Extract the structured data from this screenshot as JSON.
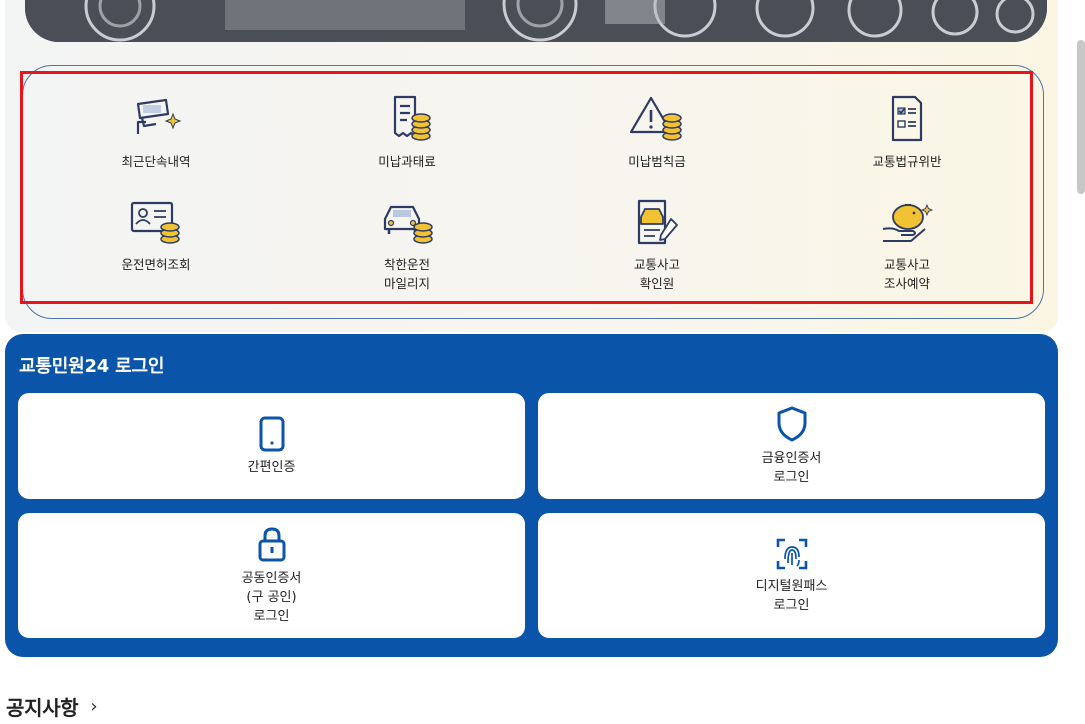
{
  "services": [
    {
      "label": "최근단속내역",
      "icon": "cctv-camera-icon"
    },
    {
      "label": "미납과태료",
      "icon": "receipt-coins-icon"
    },
    {
      "label": "미납범칙금",
      "icon": "warning-coins-icon"
    },
    {
      "label": "교통법규위반",
      "icon": "checklist-document-icon"
    },
    {
      "label": "운전면허조회",
      "icon": "license-card-coins-icon"
    },
    {
      "label": "착한운전\n마일리지",
      "icon": "car-coins-icon"
    },
    {
      "label": "교통사고\n확인원",
      "icon": "accident-document-icon"
    },
    {
      "label": "교통사고\n조사예약",
      "icon": "piggy-bank-hand-icon"
    }
  ],
  "login": {
    "title": "교통민원24 로그인",
    "buttons": [
      {
        "label": "간편인증",
        "icon": "smartphone-icon"
      },
      {
        "label": "금융인증서\n로그인",
        "icon": "shield-icon"
      },
      {
        "label": "공동인증서\n(구 공인)\n로그인",
        "icon": "lock-icon"
      },
      {
        "label": "디지털원패스\n로그인",
        "icon": "fingerprint-icon"
      }
    ]
  },
  "notice": {
    "title": "공지사항",
    "chevron": "›"
  },
  "colors": {
    "accent_blue": "#0a55a9",
    "highlight_red": "#e8141c",
    "icon_navy": "#2e3b63",
    "coin_gold": "#f1c232"
  }
}
